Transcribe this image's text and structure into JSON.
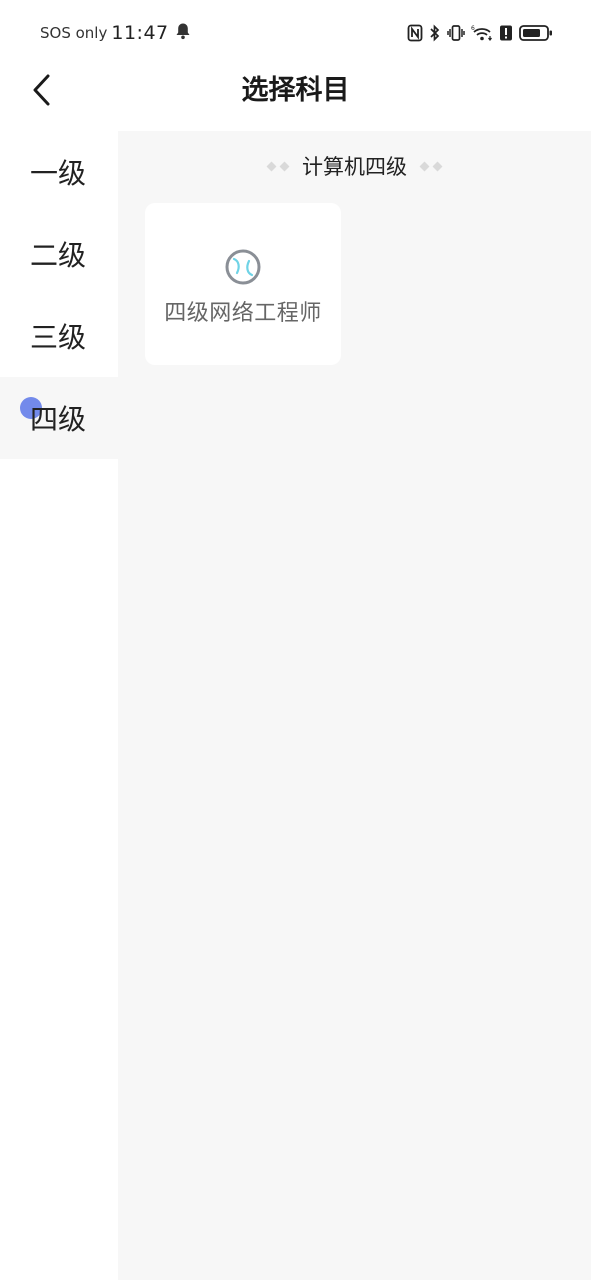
{
  "status_bar": {
    "carrier": "SOS only",
    "time": "11:47",
    "icons": [
      "bell-icon",
      "nfc-icon",
      "bluetooth-icon",
      "vibrate-icon",
      "wifi-icon",
      "alert-icon",
      "battery-icon"
    ]
  },
  "header": {
    "title": "选择科目"
  },
  "sidebar": {
    "items": [
      {
        "label": "一级"
      },
      {
        "label": "二级"
      },
      {
        "label": "三级"
      },
      {
        "label": "四级"
      }
    ],
    "active_index": 3,
    "active_dot_color": "#6b84ea"
  },
  "content": {
    "section_title": "计算机四级",
    "subjects": [
      {
        "label": "四级网络工程师",
        "icon": "baseball-icon"
      }
    ]
  },
  "colors": {
    "content_bg": "#f7f7f7",
    "card_bg": "#ffffff",
    "accent": "#6b84ea"
  }
}
